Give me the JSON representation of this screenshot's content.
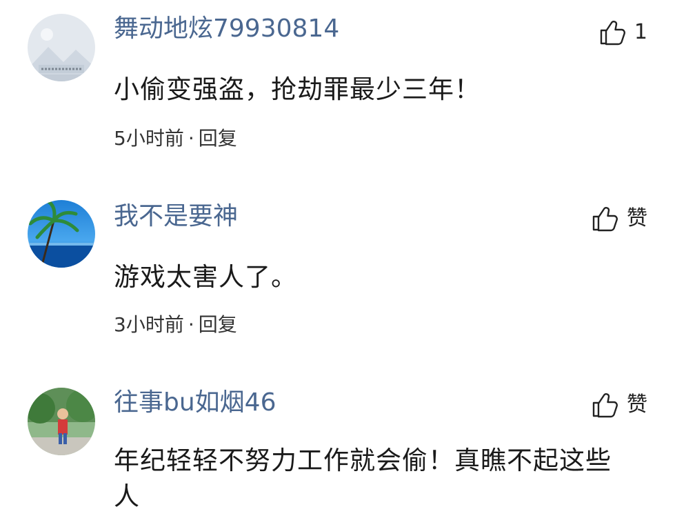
{
  "comments": [
    {
      "username": "舞动地炫79930814",
      "text": "小偷变强盗，抢劫罪最少三年！",
      "time": "5小时前",
      "separator": "·",
      "reply_label": "回复",
      "like_label": "1",
      "avatar_caption": "山水风景壁纸"
    },
    {
      "username": "我不是要神",
      "text": "游戏太害人了。",
      "time": "3小时前",
      "separator": "·",
      "reply_label": "回复",
      "like_label": "赞"
    },
    {
      "username": "往事bu如烟46",
      "text": "年纪轻轻不努力工作就会偷！真瞧不起这些人",
      "like_label": "赞"
    }
  ],
  "icons": {
    "like": "thumbs-up-icon"
  },
  "colors": {
    "username": "#4a6790",
    "text": "#1a1a1a",
    "meta": "#333333",
    "background": "#ffffff"
  }
}
